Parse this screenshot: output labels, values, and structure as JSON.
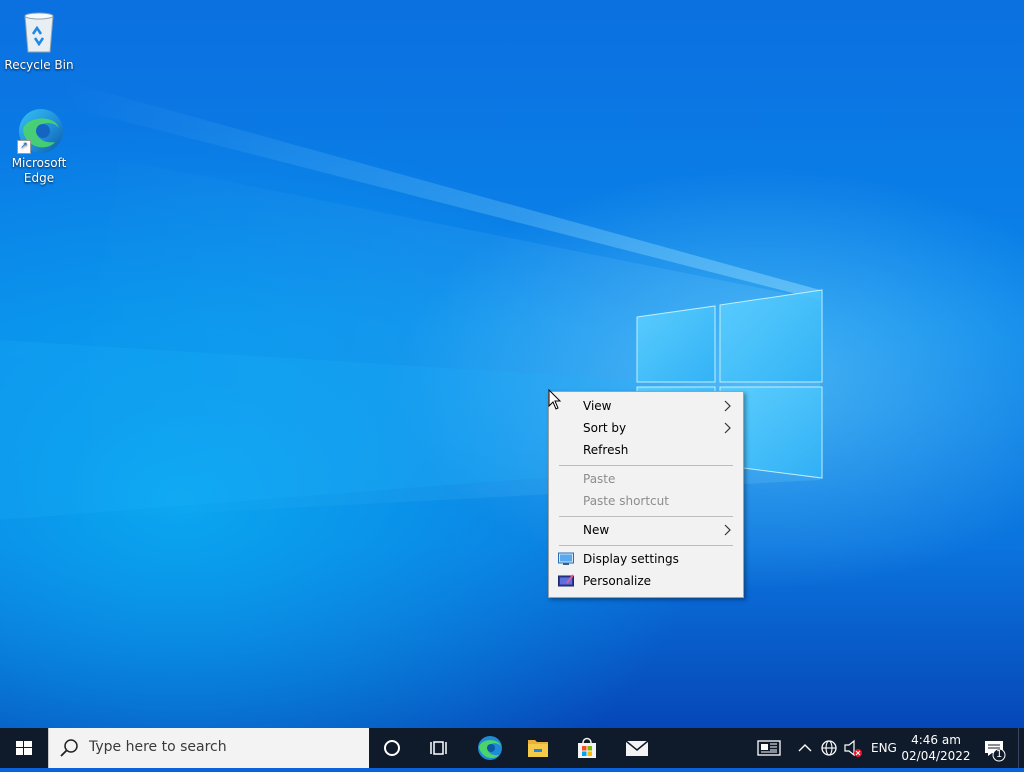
{
  "desktop": {
    "icons": [
      {
        "label": "Recycle Bin",
        "icon": "recycle-bin-icon"
      },
      {
        "label": "Microsoft\nEdge",
        "label_line1": "Microsoft",
        "label_line2": "Edge",
        "icon": "edge-icon"
      }
    ]
  },
  "context_menu": {
    "items": [
      {
        "label": "View",
        "has_submenu": true,
        "enabled": true
      },
      {
        "label": "Sort by",
        "has_submenu": true,
        "enabled": true
      },
      {
        "label": "Refresh",
        "has_submenu": false,
        "enabled": true
      },
      {
        "label": "Paste",
        "has_submenu": false,
        "enabled": false
      },
      {
        "label": "Paste shortcut",
        "has_submenu": false,
        "enabled": false
      },
      {
        "label": "New",
        "has_submenu": true,
        "enabled": true
      },
      {
        "label": "Display settings",
        "icon": "display-settings-icon",
        "enabled": true
      },
      {
        "label": "Personalize",
        "icon": "personalize-icon",
        "enabled": true
      }
    ]
  },
  "taskbar": {
    "search_placeholder": "Type here to search",
    "pinned": [
      "cortana-icon",
      "task-view-icon",
      "edge-icon",
      "file-explorer-icon",
      "microsoft-store-icon",
      "mail-icon"
    ],
    "tray": {
      "language": "ENG",
      "time": "4:46 am",
      "date": "02/04/2022",
      "notification_count": "1"
    }
  },
  "colors": {
    "taskbar_bg": "#0f1a2b",
    "menu_bg": "#f2f2f2",
    "disabled_text": "#8d8d8d",
    "accent": "#0078d7"
  }
}
